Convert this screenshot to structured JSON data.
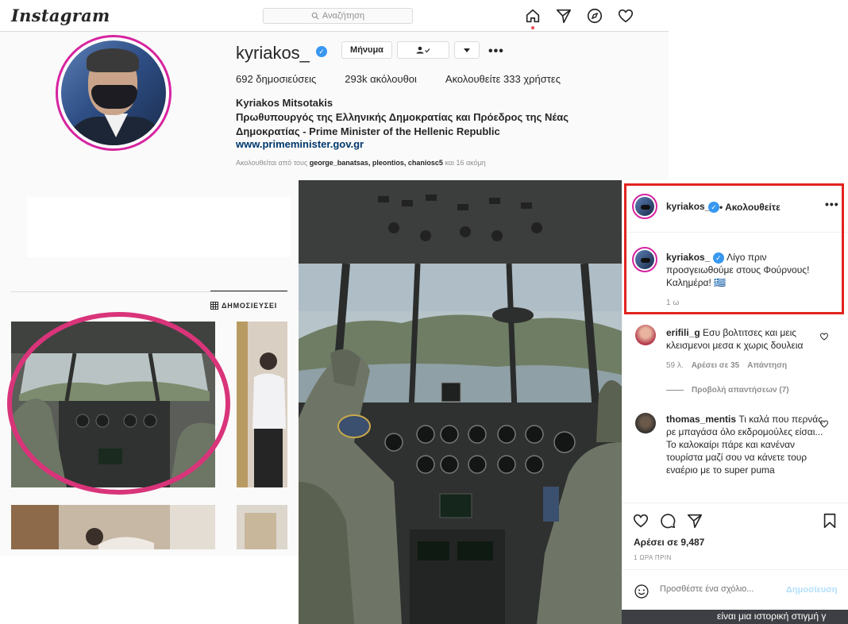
{
  "header": {
    "logo": "Instagram",
    "search_placeholder": "Αναζήτηση",
    "nav_icons": [
      "home-icon",
      "direct-icon",
      "explore-icon",
      "activity-heart-icon"
    ]
  },
  "profile": {
    "username": "kyriakos_",
    "message_button": "Μήνυμα",
    "follow_button_icon": "person-check-icon",
    "dropdown_icon": "chevron-down-icon",
    "more_options": "•••",
    "stats": {
      "posts": "692 δημοσιεύσεις",
      "followers": "293k ακόλουθοι",
      "following": "Ακολουθείτε 333 χρήστες"
    },
    "full_name": "Kyriakos Mitsotakis",
    "bio": "Πρωθυπουργός της Ελληνικής Δημοκρατίας και Πρόεδρος της Νέας Δημοκρατίας - Prime Minister of the Hellenic Republic",
    "website": "www.primeminister.gov.gr",
    "followed_by": {
      "prefix": "Ακολουθείται από τους",
      "names": "george_banatsas, pleontios, chaniosc5",
      "suffix": "και 16 ακόμη"
    },
    "tab_label": "ΔΗΜΟΣΙΕΥΣΕΙ"
  },
  "post": {
    "username": "kyriakos_",
    "follow_state": "• Ακολουθείτε",
    "more_options": "•••",
    "caption_user": "kyriakos_",
    "caption": "Λίγο πριν προσγειωθούμε στους Φούρνους! Καλημέρα! 🇬🇷",
    "caption_time": "1 ω",
    "comments": [
      {
        "user": "erifili_g",
        "text": "Εσυ βολτιτσες και μεις κλεισμενοι μεσα κ χωρις δουλεια",
        "age": "59 λ.",
        "likes": "Αρέσει σε 35",
        "reply": "Απάντηση",
        "view_replies": "Προβολή απαντήσεων (7)"
      },
      {
        "user": "thomas_mentis",
        "text": "Τι καλά που περνάς ρε μπαγάσα όλο εκδρομούλες είσαι... Το καλοκαίρι πάρε και κανέναν τουρίστα μαζί σου να κάνετε τουρ εναέριο με το super puma"
      }
    ],
    "likes": "Αρέσει σε 9,487",
    "time": "1 ΩΡΑ ΠΡΙΝ",
    "comment_placeholder": "Προσθέστε ένα σχόλιο...",
    "publish_button": "Δημοσίευση"
  },
  "background_fragment": "είναι μια ιστορική στιγμή γ",
  "colors": {
    "highlight_ellipse": "#d9347a",
    "highlight_box": "#e2241f",
    "verified": "#3897f0",
    "link": "#00376b"
  }
}
